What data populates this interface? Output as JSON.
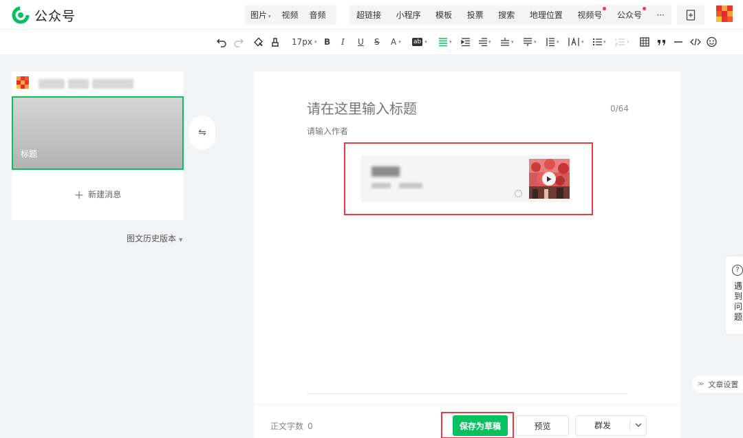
{
  "brand": {
    "name": "公众号",
    "logo_icon": "wechat-mp-logo-icon",
    "color": "#07c160"
  },
  "media_group": [
    {
      "label": "图片",
      "has_dropdown": true
    },
    {
      "label": "视频",
      "has_dropdown": false
    },
    {
      "label": "音频",
      "has_dropdown": false
    }
  ],
  "insert_group": [
    {
      "label": "超链接",
      "dot": false
    },
    {
      "label": "小程序",
      "dot": false
    },
    {
      "label": "模板",
      "dot": false
    },
    {
      "label": "投票",
      "dot": false
    },
    {
      "label": "搜索",
      "dot": false
    },
    {
      "label": "地理位置",
      "dot": false
    },
    {
      "label": "视频号",
      "dot": true
    },
    {
      "label": "公众号",
      "dot": true
    },
    {
      "label": "···",
      "dot": false
    }
  ],
  "format_toolbar": {
    "font_size": "17px",
    "bold": "B",
    "italic": "I",
    "underline": "U",
    "strikethrough": "S",
    "font_color": "A",
    "bg_color": "ab",
    "icons": [
      "undo-icon",
      "redo-icon",
      "format-painter-icon",
      "clear-format-icon",
      "align-left-icon",
      "indent-icon",
      "first-line-indent-icon",
      "spacing-before-icon",
      "spacing-after-icon",
      "line-height-icon",
      "letter-spacing-icon",
      "list-icon",
      "numbered-list-icon",
      "table-icon",
      "quote-icon",
      "divider-icon",
      "code-icon",
      "emoji-icon"
    ]
  },
  "left_panel": {
    "cover_title": "标题",
    "new_message": "新建消息",
    "history": "图文历史版本"
  },
  "editor": {
    "title_placeholder": "请在这里输入标题",
    "title_count": "0/64",
    "author_placeholder": "请输入作者",
    "highlight_color": "#e53a3f"
  },
  "bottom_bar": {
    "word_count_label": "正文字数",
    "word_count": "0",
    "save_draft": "保存为草稿",
    "preview": "预览",
    "mass_send": "群发"
  },
  "help": {
    "text": "遇到问题"
  },
  "article_settings": "文章设置"
}
